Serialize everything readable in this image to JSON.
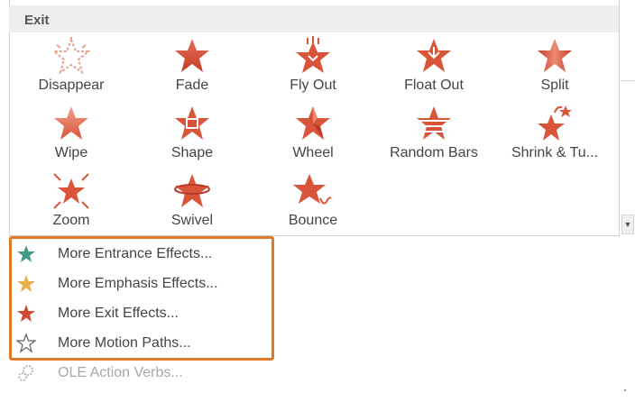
{
  "section_header": "Exit",
  "effects": [
    {
      "label": "Disappear",
      "icon": "disappear-star-icon"
    },
    {
      "label": "Fade",
      "icon": "fade-star-icon"
    },
    {
      "label": "Fly Out",
      "icon": "fly-out-star-icon"
    },
    {
      "label": "Float Out",
      "icon": "float-out-star-icon"
    },
    {
      "label": "Split",
      "icon": "split-star-icon"
    },
    {
      "label": "Wipe",
      "icon": "wipe-star-icon"
    },
    {
      "label": "Shape",
      "icon": "shape-star-icon"
    },
    {
      "label": "Wheel",
      "icon": "wheel-star-icon"
    },
    {
      "label": "Random Bars",
      "icon": "random-bars-star-icon"
    },
    {
      "label": "Shrink & Tu...",
      "icon": "shrink-turn-star-icon"
    },
    {
      "label": "Zoom",
      "icon": "zoom-star-icon"
    },
    {
      "label": "Swivel",
      "icon": "swivel-star-icon"
    },
    {
      "label": "Bounce",
      "icon": "bounce-star-icon"
    }
  ],
  "menu": [
    {
      "label": "More Entrance Effects...",
      "icon": "green-star-icon",
      "color": "#3f9a83"
    },
    {
      "label": "More Emphasis Effects...",
      "icon": "gold-star-icon",
      "color": "#e8b04a"
    },
    {
      "label": "More Exit Effects...",
      "icon": "red-star-icon",
      "color": "#cf4a2f"
    },
    {
      "label": "More Motion Paths...",
      "icon": "outline-star-icon",
      "color": "#666666"
    },
    {
      "label": "OLE Action Verbs...",
      "icon": "gear-icon",
      "color": "#b8b8b8"
    }
  ],
  "colors": {
    "star_red": "#d9553a",
    "star_red_dark": "#b83a22",
    "highlight_orange": "#dc7a2a"
  }
}
